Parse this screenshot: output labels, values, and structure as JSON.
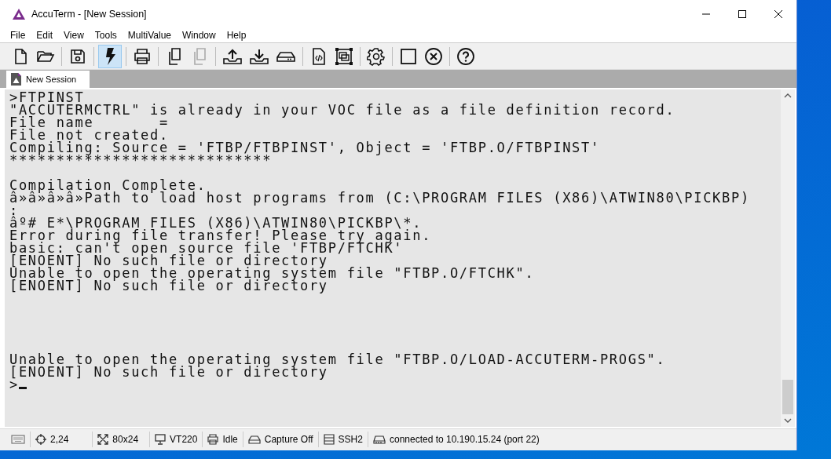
{
  "window": {
    "title": "AccuTerm - [New Session]"
  },
  "menu": [
    "File",
    "Edit",
    "View",
    "Tools",
    "MultiValue",
    "Window",
    "Help"
  ],
  "toolbar": [
    [
      {
        "kind": "new-file",
        "selected": false,
        "disabled": false
      },
      {
        "kind": "open-folder",
        "selected": false,
        "disabled": false
      }
    ],
    [
      {
        "kind": "save",
        "selected": false,
        "disabled": false
      }
    ],
    [
      {
        "kind": "lightning",
        "selected": true,
        "disabled": false
      }
    ],
    [
      {
        "kind": "print",
        "selected": false,
        "disabled": false
      }
    ],
    [
      {
        "kind": "copy",
        "selected": false,
        "disabled": false
      },
      {
        "kind": "paste",
        "selected": false,
        "disabled": true
      }
    ],
    [
      {
        "kind": "upload",
        "selected": false,
        "disabled": false
      },
      {
        "kind": "download",
        "selected": false,
        "disabled": false
      },
      {
        "kind": "drive",
        "selected": false,
        "disabled": false
      }
    ],
    [
      {
        "kind": "code-file",
        "selected": false,
        "disabled": false
      },
      {
        "kind": "capture",
        "selected": false,
        "disabled": false
      }
    ],
    [
      {
        "kind": "settings",
        "selected": false,
        "disabled": false
      }
    ],
    [
      {
        "kind": "square",
        "selected": false,
        "disabled": false
      },
      {
        "kind": "close-circle",
        "selected": false,
        "disabled": false
      }
    ],
    [
      {
        "kind": "help",
        "selected": false,
        "disabled": false
      }
    ]
  ],
  "tabs": [
    {
      "label": "New Session",
      "selected": true
    }
  ],
  "terminal": {
    "blocks": [
      [
        ">FTPINST",
        "\"ACCUTERMCTRL\" is already in your VOC file as a file definition record.",
        "File name       =",
        "File not created.",
        "Compiling: Source = 'FTBP/FTBPINST', Object = 'FTBP.O/FTBPINST'",
        "****************************"
      ],
      [
        "Compilation Complete.",
        "â»â»â»â»Path to load host programs from (C:\\PROGRAM FILES (X86)\\ATWIN80\\PICKBP)",
        ":",
        "âº# E*\\PROGRAM FILES (X86)\\ATWIN80\\PICKBP\\*.",
        "Error during file transfer! Please try again.",
        "basic: can't open source file 'FTBP/FTCHK'",
        "[ENOENT] No such file or directory",
        "Unable to open the operating system file \"FTBP.O/FTCHK\".",
        "[ENOENT] No such file or directory"
      ],
      [
        "Unable to open the operating system file \"FTBP.O/LOAD-ACCUTERM-PROGS\".",
        "[ENOENT] No such file or directory",
        ">"
      ]
    ],
    "cursor": true
  },
  "status_bar": [
    {
      "kind": "keyboard"
    },
    {
      "kind": "position",
      "text": "2,24"
    },
    {
      "kind": "size",
      "text": "80x24"
    },
    {
      "kind": "terminal",
      "text": "VT220"
    },
    {
      "kind": "printer",
      "text": "Idle"
    },
    {
      "kind": "capture",
      "text": "Capture Off"
    },
    {
      "kind": "protocol",
      "text": "SSH2"
    },
    {
      "kind": "connection",
      "text": "connected to 10.190.15.24 (port 22)"
    }
  ]
}
